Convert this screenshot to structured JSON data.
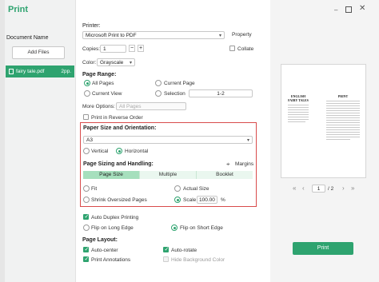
{
  "window": {
    "title": "Print"
  },
  "sidebar": {
    "heading": "Document Name",
    "add_files_label": "Add Files",
    "file": {
      "name": "fairy tale.pdf",
      "pages": "2pp."
    }
  },
  "printer": {
    "label": "Printer:",
    "selected": "Microsoft Print to PDF",
    "property_label": "Property",
    "copies_label": "Copies:",
    "copies_value": "1",
    "collate_label": "Collate",
    "color_label": "Color:",
    "color_value": "Grayscale"
  },
  "page_range": {
    "label": "Page Range:",
    "all_pages": "All Pages",
    "current_page": "Current Page",
    "current_view": "Current View",
    "selection": "Selection",
    "selection_value": "1-2",
    "more_options_label": "More Options:",
    "more_options_value": "All Pages",
    "print_reverse": "Print in Reverse Order"
  },
  "paper": {
    "label": "Paper Size and Orientation:",
    "size_value": "A3",
    "vertical": "Vertical",
    "horizontal": "Horizontal"
  },
  "sizing": {
    "label": "Page Sizing and Handling:",
    "margins_label": "Margins",
    "tabs": [
      "Page Size",
      "Multiple",
      "Booklet"
    ],
    "fit": "Fit",
    "actual_size": "Actual Size",
    "shrink": "Shrink Oversized Pages",
    "scale_label": "Scale",
    "scale_value": "100.00",
    "scale_unit": "%"
  },
  "duplex": {
    "auto_duplex": "Auto Duplex Printing",
    "long_edge": "Flip on Long Edge",
    "short_edge": "Flip on Short Edge"
  },
  "layout": {
    "label": "Page Layout:",
    "auto_center": "Auto-center",
    "auto_rotate": "Auto-rotate",
    "print_annotations": "Print Annotations",
    "hide_background": "Hide Background Color"
  },
  "preview": {
    "doc_title_line1": "ENGLISH",
    "doc_title_line2": "FAIRY TALES",
    "doc_heading": "PRINT",
    "page_input": "1",
    "page_total": "/ 2",
    "first_icon": "«",
    "prev_icon": "‹",
    "next_icon": "›",
    "last_icon": "»"
  },
  "actions": {
    "print_label": "Print"
  },
  "icons": {
    "minimize": "minimize-icon",
    "maximize": "maximize-icon",
    "close": "close-icon"
  },
  "colors": {
    "accent": "#2ea36f",
    "highlight": "#d84b4b",
    "tab_active": "#a6dfbd"
  }
}
